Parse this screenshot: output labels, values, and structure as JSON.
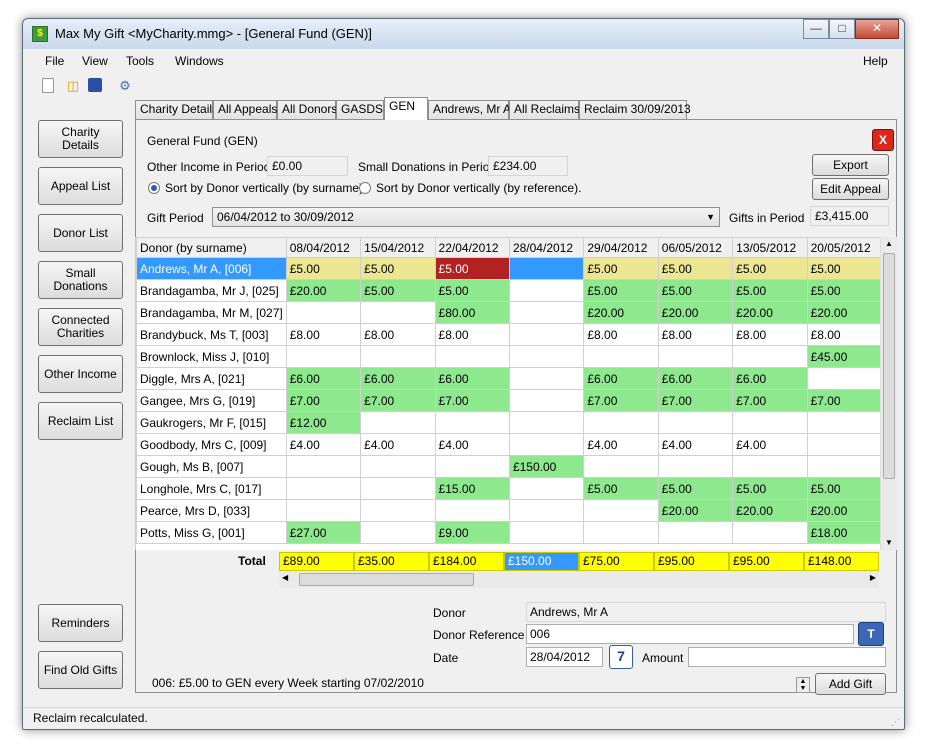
{
  "window": {
    "title": "Max My Gift <MyCharity.mmg>  - [General Fund (GEN)]"
  },
  "menu": {
    "file": "File",
    "view": "View",
    "tools": "Tools",
    "windows": "Windows",
    "help": "Help"
  },
  "sidebar": {
    "charity_details": "Charity Details",
    "appeal_list": "Appeal List",
    "donor_list": "Donor List",
    "small_donations": "Small Donations",
    "connected_charities": "Connected Charities",
    "other_income": "Other Income",
    "reclaim_list": "Reclaim List",
    "reminders": "Reminders",
    "find_old_gifts": "Find Old Gifts"
  },
  "tabs": [
    "Charity Details",
    "All Appeals",
    "All Donors",
    "GASDS",
    "GEN",
    "Andrews, Mr A",
    "All Reclaims",
    "Reclaim 30/09/2013"
  ],
  "panel": {
    "heading": "General Fund (GEN)",
    "other_income_label": "Other Income in Period",
    "other_income_value": "£0.00",
    "small_donations_label": "Small Donations in Period",
    "small_donations_value": "£234.00",
    "sort_surname": "Sort by Donor vertically (by surname).",
    "sort_reference": "Sort by Donor vertically (by reference).",
    "gift_period_label": "Gift Period",
    "gift_period_value": "06/04/2012 to 30/09/2012",
    "gifts_in_period_label": "Gifts in Period",
    "gifts_in_period_value": "£3,415.00",
    "export": "Export",
    "edit_appeal": "Edit Appeal",
    "close_x": "X"
  },
  "grid": {
    "corner": "Donor (by surname)",
    "dates": [
      "08/04/2012",
      "15/04/2012",
      "22/04/2012",
      "28/04/2012",
      "29/04/2012",
      "06/05/2012",
      "13/05/2012",
      "20/05/2012"
    ],
    "rows": [
      {
        "name": "Andrews, Mr A, [006]",
        "cells": [
          "£5.00",
          "£5.00",
          "£5.00",
          "",
          "£5.00",
          "£5.00",
          "£5.00",
          "£5.00"
        ],
        "classes": [
          "y",
          "y",
          "r",
          "b",
          "y",
          "y",
          "y",
          "y"
        ]
      },
      {
        "name": "Brandagamba, Mr J, [025]",
        "cells": [
          "£20.00",
          "£5.00",
          "£5.00",
          "",
          "£5.00",
          "£5.00",
          "£5.00",
          "£5.00"
        ],
        "classes": [
          "g",
          "g",
          "g",
          "",
          "g",
          "g",
          "g",
          "g"
        ]
      },
      {
        "name": "Brandagamba, Mr M, [027]",
        "cells": [
          "",
          "",
          "£80.00",
          "",
          "£20.00",
          "£20.00",
          "£20.00",
          "£20.00"
        ],
        "classes": [
          "",
          "",
          "g",
          "",
          "g",
          "g",
          "g",
          "g"
        ]
      },
      {
        "name": "Brandybuck, Ms T, [003]",
        "cells": [
          "£8.00",
          "£8.00",
          "£8.00",
          "",
          "£8.00",
          "£8.00",
          "£8.00",
          "£8.00"
        ],
        "classes": [
          "",
          "",
          "",
          "",
          "",
          "",
          "",
          ""
        ]
      },
      {
        "name": "Brownlock, Miss J, [010]",
        "cells": [
          "",
          "",
          "",
          "",
          "",
          "",
          "",
          "£45.00"
        ],
        "classes": [
          "",
          "",
          "",
          "",
          "",
          "",
          "",
          "g"
        ]
      },
      {
        "name": "Diggle, Mrs A, [021]",
        "cells": [
          "£6.00",
          "£6.00",
          "£6.00",
          "",
          "£6.00",
          "£6.00",
          "£6.00",
          ""
        ],
        "classes": [
          "g",
          "g",
          "g",
          "",
          "g",
          "g",
          "g",
          ""
        ]
      },
      {
        "name": "Gangee, Mrs G, [019]",
        "cells": [
          "£7.00",
          "£7.00",
          "£7.00",
          "",
          "£7.00",
          "£7.00",
          "£7.00",
          "£7.00"
        ],
        "classes": [
          "g",
          "g",
          "g",
          "",
          "g",
          "g",
          "g",
          "g"
        ]
      },
      {
        "name": "Gaukrogers, Mr F, [015]",
        "cells": [
          "£12.00",
          "",
          "",
          "",
          "",
          "",
          "",
          ""
        ],
        "classes": [
          "g",
          "",
          "",
          "",
          "",
          "",
          "",
          ""
        ]
      },
      {
        "name": "Goodbody, Mrs C, [009]",
        "cells": [
          "£4.00",
          "£4.00",
          "£4.00",
          "",
          "£4.00",
          "£4.00",
          "£4.00",
          ""
        ],
        "classes": [
          "",
          "",
          "",
          "",
          "",
          "",
          "",
          ""
        ]
      },
      {
        "name": "Gough, Ms B, [007]",
        "cells": [
          "",
          "",
          "",
          "£150.00",
          "",
          "",
          "",
          ""
        ],
        "classes": [
          "",
          "",
          "",
          "g",
          "",
          "",
          "",
          ""
        ]
      },
      {
        "name": "Longhole, Mrs C, [017]",
        "cells": [
          "",
          "",
          "£15.00",
          "",
          "£5.00",
          "£5.00",
          "£5.00",
          "£5.00"
        ],
        "classes": [
          "",
          "",
          "g",
          "",
          "g",
          "g",
          "g",
          "g"
        ]
      },
      {
        "name": "Pearce, Mrs D, [033]",
        "cells": [
          "",
          "",
          "",
          "",
          "",
          "£20.00",
          "£20.00",
          "£20.00"
        ],
        "classes": [
          "",
          "",
          "",
          "",
          "",
          "g",
          "g",
          "g"
        ]
      },
      {
        "name": "Potts, Miss G, [001]",
        "cells": [
          "£27.00",
          "",
          "£9.00",
          "",
          "",
          "",
          "",
          "£18.00"
        ],
        "classes": [
          "g",
          "",
          "g",
          "",
          "",
          "",
          "",
          "g"
        ]
      }
    ],
    "total_label": "Total",
    "totals": [
      "£89.00",
      "£35.00",
      "£184.00",
      "£150.00",
      "£75.00",
      "£95.00",
      "£95.00",
      "£148.00"
    ]
  },
  "details": {
    "donor_label": "Donor",
    "donor_value": "Andrews, Mr A",
    "donor_ref_label": "Donor Reference",
    "donor_ref_value": "006",
    "date_label": "Date",
    "date_value": "28/04/2012",
    "calendar_num": "7",
    "amount_label": "Amount",
    "amount_value": "",
    "schedule": "006: £5.00 to GEN every Week starting 07/02/2010",
    "add_gift": "Add Gift"
  },
  "status": {
    "text": "Reclaim recalculated."
  }
}
